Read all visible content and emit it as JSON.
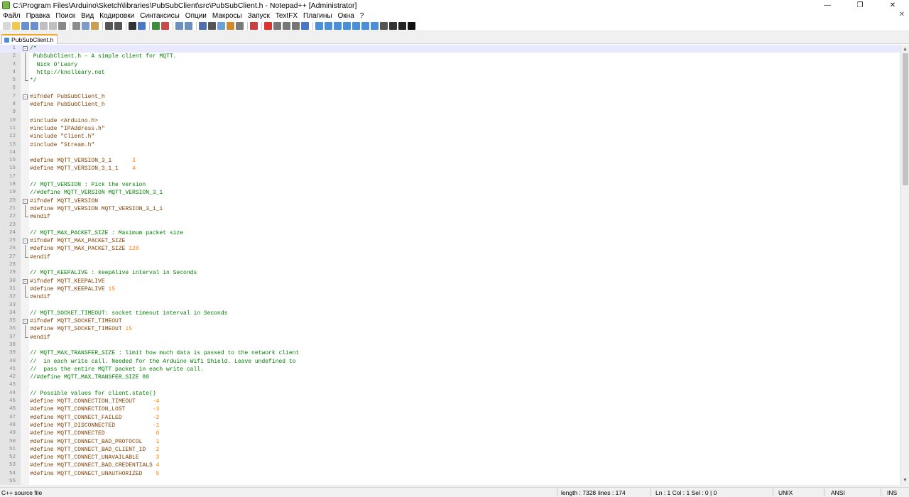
{
  "window": {
    "title": "C:\\Program Files\\Arduino\\Sketch\\libraries\\PubSubClient\\src\\PubSubClient.h - Notepad++ [Administrator]",
    "minimize": "—",
    "maximize": "❐",
    "close": "✕"
  },
  "menu": {
    "items": [
      "Файл",
      "Правка",
      "Поиск",
      "Вид",
      "Кодировки",
      "Синтаксисы",
      "Опции",
      "Макросы",
      "Запуск",
      "TextFX",
      "Плагины",
      "Окна",
      "?"
    ],
    "close": "✕"
  },
  "toolbar": {
    "icons": [
      "new-file-icon",
      "open-file-icon",
      "save-icon",
      "save-all-icon",
      "close-icon",
      "close-all-icon",
      "print-icon",
      "cut-icon",
      "copy-icon",
      "paste-icon",
      "undo-icon",
      "redo-icon",
      "find-icon",
      "replace-icon",
      "zoom-in-icon",
      "zoom-out-icon",
      "sync-v-icon",
      "sync-h-icon",
      "word-wrap-icon",
      "show-all-chars-icon",
      "indent-guide-icon",
      "doc-map-icon",
      "function-list-icon",
      "folder-workspace-icon",
      "record-macro-icon",
      "stop-macro-icon",
      "play-macro-icon",
      "play-multiple-icon",
      "save-macro-icon",
      "plugin-a-icon",
      "plugin-b-icon",
      "plugin-c-icon",
      "plugin-d-icon",
      "plugin-e-icon",
      "plugin-f-icon",
      "plugin-g-icon",
      "plugin-h-icon",
      "plugin-i-icon",
      "plugin-j-icon",
      "plugin-k-icon"
    ]
  },
  "tabs": [
    {
      "label": "PubSubClient.h"
    }
  ],
  "editor": {
    "lines": [
      {
        "n": "1",
        "fold": "box",
        "segs": [
          {
            "t": "/*",
            "c": "comment"
          }
        ]
      },
      {
        "n": "2",
        "fold": "line",
        "segs": [
          {
            "t": " PubSubClient.h - A simple client for MQTT.",
            "c": "comment"
          }
        ]
      },
      {
        "n": "3",
        "fold": "line",
        "segs": [
          {
            "t": "  Nick O'Leary",
            "c": "comment"
          }
        ]
      },
      {
        "n": "4",
        "fold": "line",
        "segs": [
          {
            "t": "  http://knolleary.net",
            "c": "comment"
          }
        ]
      },
      {
        "n": "5",
        "fold": "end",
        "segs": [
          {
            "t": "*/",
            "c": "comment"
          }
        ]
      },
      {
        "n": "6",
        "fold": "",
        "segs": []
      },
      {
        "n": "7",
        "fold": "box",
        "segs": [
          {
            "t": "#ifndef PubSubClient_h",
            "c": "pre"
          }
        ]
      },
      {
        "n": "8",
        "fold": "",
        "segs": [
          {
            "t": "#define PubSubClient_h",
            "c": "pre"
          }
        ]
      },
      {
        "n": "9",
        "fold": "",
        "segs": []
      },
      {
        "n": "10",
        "fold": "",
        "segs": [
          {
            "t": "#include <Arduino.h>",
            "c": "pre"
          }
        ]
      },
      {
        "n": "11",
        "fold": "",
        "segs": [
          {
            "t": "#include \"IPAddress.h\"",
            "c": "pre"
          }
        ]
      },
      {
        "n": "12",
        "fold": "",
        "segs": [
          {
            "t": "#include \"Client.h\"",
            "c": "pre"
          }
        ]
      },
      {
        "n": "13",
        "fold": "",
        "segs": [
          {
            "t": "#include \"Stream.h\"",
            "c": "pre"
          }
        ]
      },
      {
        "n": "14",
        "fold": "",
        "segs": []
      },
      {
        "n": "15",
        "fold": "",
        "segs": [
          {
            "t": "#define MQTT_VERSION_3_1      ",
            "c": "pre"
          },
          {
            "t": "3",
            "c": "num"
          }
        ]
      },
      {
        "n": "16",
        "fold": "",
        "segs": [
          {
            "t": "#define MQTT_VERSION_3_1_1    ",
            "c": "pre"
          },
          {
            "t": "4",
            "c": "num"
          }
        ]
      },
      {
        "n": "17",
        "fold": "",
        "segs": []
      },
      {
        "n": "18",
        "fold": "",
        "segs": [
          {
            "t": "// MQTT_VERSION : Pick the version",
            "c": "comment"
          }
        ]
      },
      {
        "n": "19",
        "fold": "",
        "segs": [
          {
            "t": "//#define MQTT_VERSION MQTT_VERSION_3_1",
            "c": "comment"
          }
        ]
      },
      {
        "n": "20",
        "fold": "box",
        "segs": [
          {
            "t": "#ifndef MQTT_VERSION",
            "c": "pre"
          }
        ]
      },
      {
        "n": "21",
        "fold": "line",
        "segs": [
          {
            "t": "#define MQTT_VERSION MQTT_VERSION_3_1_1",
            "c": "pre"
          }
        ]
      },
      {
        "n": "22",
        "fold": "end",
        "segs": [
          {
            "t": "#endif",
            "c": "pre"
          }
        ]
      },
      {
        "n": "23",
        "fold": "",
        "segs": []
      },
      {
        "n": "24",
        "fold": "",
        "segs": [
          {
            "t": "// MQTT_MAX_PACKET_SIZE : Maximum packet size",
            "c": "comment"
          }
        ]
      },
      {
        "n": "25",
        "fold": "box",
        "segs": [
          {
            "t": "#ifndef MQTT_MAX_PACKET_SIZE",
            "c": "pre"
          }
        ]
      },
      {
        "n": "26",
        "fold": "line",
        "segs": [
          {
            "t": "#define MQTT_MAX_PACKET_SIZE ",
            "c": "pre"
          },
          {
            "t": "128",
            "c": "num"
          }
        ]
      },
      {
        "n": "27",
        "fold": "end",
        "segs": [
          {
            "t": "#endif",
            "c": "pre"
          }
        ]
      },
      {
        "n": "28",
        "fold": "",
        "segs": []
      },
      {
        "n": "29",
        "fold": "",
        "segs": [
          {
            "t": "// MQTT_KEEPALIVE : keepAlive interval in Seconds",
            "c": "comment"
          }
        ]
      },
      {
        "n": "30",
        "fold": "box",
        "segs": [
          {
            "t": "#ifndef MQTT_KEEPALIVE",
            "c": "pre"
          }
        ]
      },
      {
        "n": "31",
        "fold": "line",
        "segs": [
          {
            "t": "#define MQTT_KEEPALIVE ",
            "c": "pre"
          },
          {
            "t": "15",
            "c": "num"
          }
        ]
      },
      {
        "n": "32",
        "fold": "end",
        "segs": [
          {
            "t": "#endif",
            "c": "pre"
          }
        ]
      },
      {
        "n": "33",
        "fold": "",
        "segs": []
      },
      {
        "n": "34",
        "fold": "",
        "segs": [
          {
            "t": "// MQTT_SOCKET_TIMEOUT: socket timeout interval in Seconds",
            "c": "comment"
          }
        ]
      },
      {
        "n": "35",
        "fold": "box",
        "segs": [
          {
            "t": "#ifndef MQTT_SOCKET_TIMEOUT",
            "c": "pre"
          }
        ]
      },
      {
        "n": "36",
        "fold": "line",
        "segs": [
          {
            "t": "#define MQTT_SOCKET_TIMEOUT ",
            "c": "pre"
          },
          {
            "t": "15",
            "c": "num"
          }
        ]
      },
      {
        "n": "37",
        "fold": "end",
        "segs": [
          {
            "t": "#endif",
            "c": "pre"
          }
        ]
      },
      {
        "n": "38",
        "fold": "",
        "segs": []
      },
      {
        "n": "39",
        "fold": "",
        "segs": [
          {
            "t": "// MQTT_MAX_TRANSFER_SIZE : limit how much data is passed to the network client",
            "c": "comment"
          }
        ]
      },
      {
        "n": "40",
        "fold": "",
        "segs": [
          {
            "t": "//  in each write call. Needed for the Arduino Wifi Shield. Leave undefined to",
            "c": "comment"
          }
        ]
      },
      {
        "n": "41",
        "fold": "",
        "segs": [
          {
            "t": "//  pass the entire MQTT packet in each write call.",
            "c": "comment"
          }
        ]
      },
      {
        "n": "42",
        "fold": "",
        "segs": [
          {
            "t": "//#define MQTT_MAX_TRANSFER_SIZE 80",
            "c": "comment"
          }
        ]
      },
      {
        "n": "43",
        "fold": "",
        "segs": []
      },
      {
        "n": "44",
        "fold": "",
        "segs": [
          {
            "t": "// Possible values for client.state()",
            "c": "comment"
          }
        ]
      },
      {
        "n": "45",
        "fold": "",
        "segs": [
          {
            "t": "#define MQTT_CONNECTION_TIMEOUT     ",
            "c": "pre"
          },
          {
            "t": "-4",
            "c": "num"
          }
        ]
      },
      {
        "n": "46",
        "fold": "",
        "segs": [
          {
            "t": "#define MQTT_CONNECTION_LOST        ",
            "c": "pre"
          },
          {
            "t": "-3",
            "c": "num"
          }
        ]
      },
      {
        "n": "47",
        "fold": "",
        "segs": [
          {
            "t": "#define MQTT_CONNECT_FAILED         ",
            "c": "pre"
          },
          {
            "t": "-2",
            "c": "num"
          }
        ]
      },
      {
        "n": "48",
        "fold": "",
        "segs": [
          {
            "t": "#define MQTT_DISCONNECTED           ",
            "c": "pre"
          },
          {
            "t": "-1",
            "c": "num"
          }
        ]
      },
      {
        "n": "49",
        "fold": "",
        "segs": [
          {
            "t": "#define MQTT_CONNECTED               ",
            "c": "pre"
          },
          {
            "t": "0",
            "c": "num"
          }
        ]
      },
      {
        "n": "50",
        "fold": "",
        "segs": [
          {
            "t": "#define MQTT_CONNECT_BAD_PROTOCOL    ",
            "c": "pre"
          },
          {
            "t": "1",
            "c": "num"
          }
        ]
      },
      {
        "n": "51",
        "fold": "",
        "segs": [
          {
            "t": "#define MQTT_CONNECT_BAD_CLIENT_ID   ",
            "c": "pre"
          },
          {
            "t": "2",
            "c": "num"
          }
        ]
      },
      {
        "n": "52",
        "fold": "",
        "segs": [
          {
            "t": "#define MQTT_CONNECT_UNAVAILABLE     ",
            "c": "pre"
          },
          {
            "t": "3",
            "c": "num"
          }
        ]
      },
      {
        "n": "53",
        "fold": "",
        "segs": [
          {
            "t": "#define MQTT_CONNECT_BAD_CREDENTIALS ",
            "c": "pre"
          },
          {
            "t": "4",
            "c": "num"
          }
        ]
      },
      {
        "n": "54",
        "fold": "",
        "segs": [
          {
            "t": "#define MQTT_CONNECT_UNAUTHORIZED    ",
            "c": "pre"
          },
          {
            "t": "5",
            "c": "num"
          }
        ]
      },
      {
        "n": "55",
        "fold": "",
        "segs": []
      }
    ]
  },
  "statusbar": {
    "file_type": "C++ source file",
    "length": "length : 7328",
    "lines": "lines : 174",
    "position": "Ln : 1    Col : 1    Sel : 0 | 0",
    "eol": "UNIX",
    "encoding": "ANSI",
    "mode": "INS"
  },
  "colors": {
    "comment": "#008000",
    "preprocessor": "#804000",
    "number": "#ff8000",
    "tab_accent": "#f5a623"
  }
}
